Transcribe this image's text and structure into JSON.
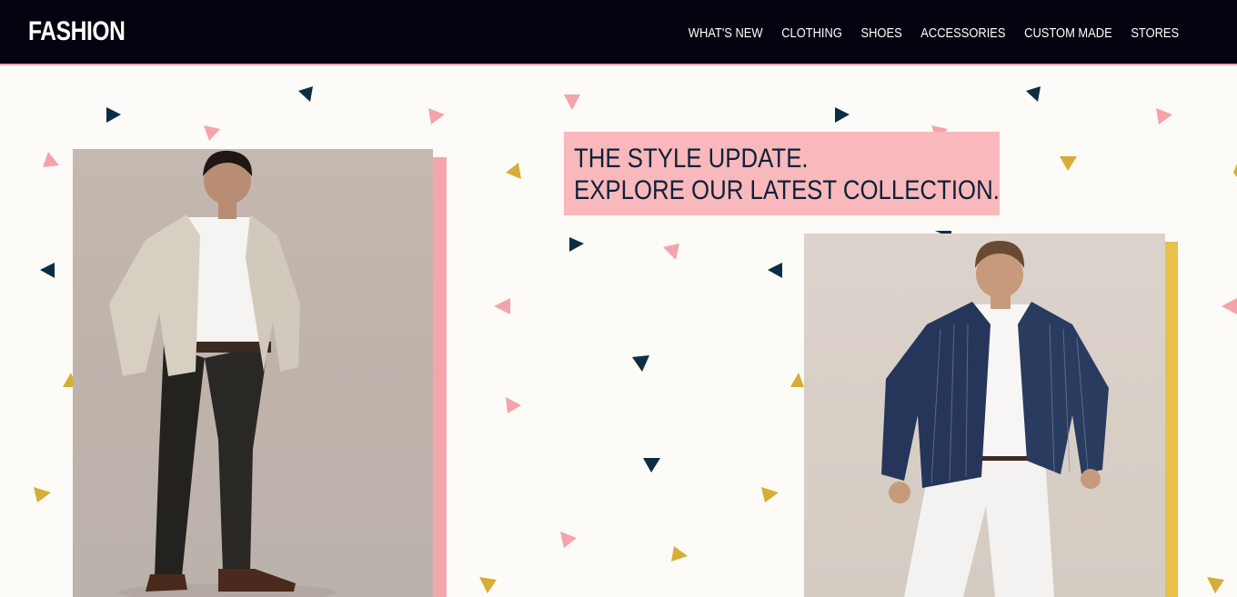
{
  "brand": {
    "logo_text": "FASHION"
  },
  "nav": {
    "items": [
      {
        "label": "WHAT'S NEW"
      },
      {
        "label": "CLOTHING"
      },
      {
        "label": "SHOES"
      },
      {
        "label": "ACCESSORIES"
      },
      {
        "label": "CUSTOM MADE"
      },
      {
        "label": "STORES"
      }
    ]
  },
  "hero": {
    "headline_line1": "THE STYLE UPDATE.",
    "headline_line2": "EXPLORE OUR LATEST COLLECTION."
  },
  "colors": {
    "navbar_bg": "#03040f",
    "page_bg": "#fcfbf7",
    "accent_pink": "#f9b8bb",
    "accent_yellow": "#e8c04a",
    "accent_navy": "#0c2e45",
    "text_dark": "#0c2138"
  },
  "images": {
    "left_model": "man-in-beige-blazer-and-black-trousers-icon",
    "right_model": "man-in-navy-pinstripe-blazer-and-white-trousers-icon"
  }
}
